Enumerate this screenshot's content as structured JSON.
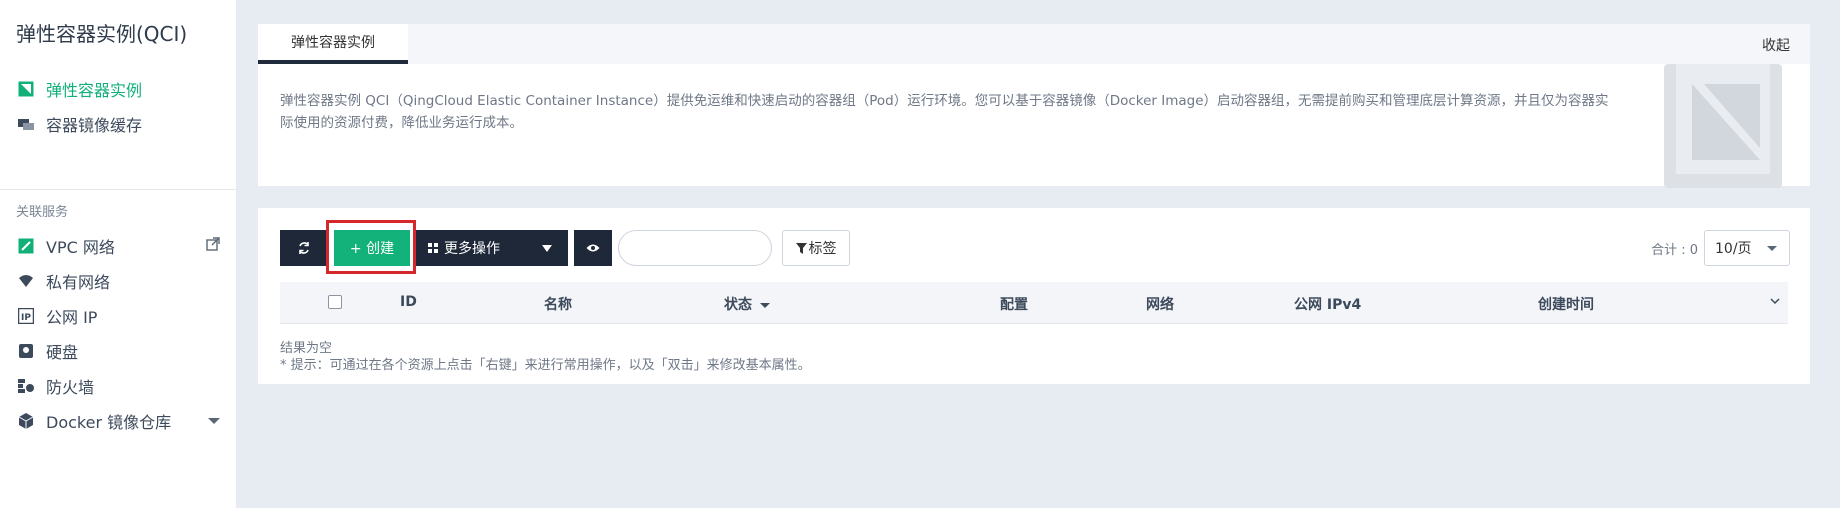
{
  "app_title": "弹性容器实例(QCI)",
  "sidebar": {
    "items": [
      {
        "label": "弹性容器实例",
        "icon": "container-instance-icon",
        "active": true
      },
      {
        "label": "容器镜像缓存",
        "icon": "image-cache-icon",
        "active": false
      }
    ],
    "related_label": "关联服务",
    "related": [
      {
        "label": "VPC 网络",
        "icon": "vpc-icon"
      },
      {
        "label": "私有网络",
        "icon": "wifi-icon"
      },
      {
        "label": "公网 IP",
        "icon": "ip-icon"
      },
      {
        "label": "硬盘",
        "icon": "disk-icon"
      },
      {
        "label": "防火墙",
        "icon": "firewall-icon"
      },
      {
        "label": "Docker 镜像仓库",
        "icon": "cube-icon"
      }
    ]
  },
  "desc": {
    "tab": "弹性容器实例",
    "collapse": "收起",
    "text": "弹性容器实例 QCI（QingCloud Elastic Container Instance）提供免运维和快速启动的容器组（Pod）运行环境。您可以基于容器镜像（Docker Image）启动容器组，无需提前购买和管理底层计算资源，并且仅为容器实际使用的资源付费，降低业务运行成本。"
  },
  "toolbar": {
    "create": "+ 创建",
    "more": "更多操作",
    "tag": "标签",
    "search_placeholder": "",
    "total": "合计 : 0",
    "page_size": "10/页"
  },
  "table": {
    "columns": [
      "ID",
      "名称",
      "状态",
      "配置",
      "网络",
      "公网 IPv4",
      "创建时间"
    ]
  },
  "empty": {
    "title": "结果为空",
    "hint": "* 提示：可通过在各个资源上点击「右键」来进行常用操作，以及「双击」来修改基本属性。"
  },
  "colors": {
    "accent": "#13b27b",
    "dark": "#1e2838",
    "highlight": "#d6272d"
  }
}
